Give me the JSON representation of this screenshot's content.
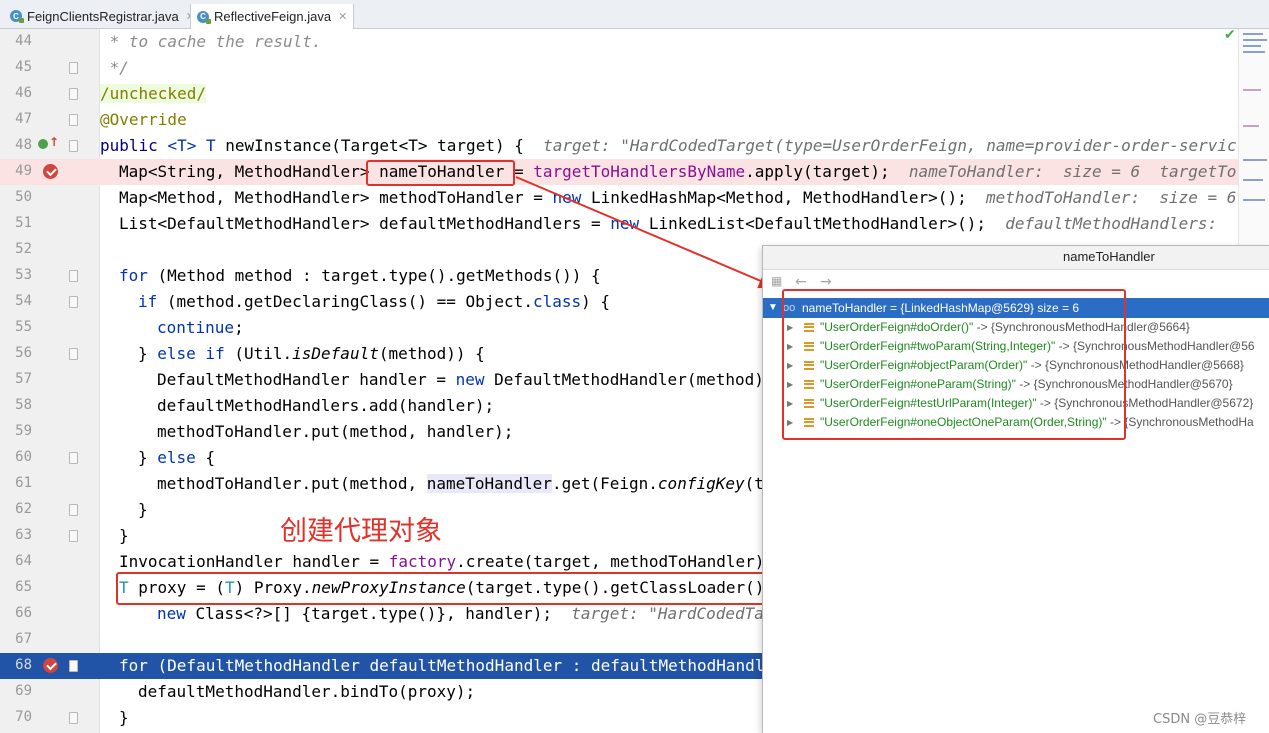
{
  "tabs": [
    {
      "label": "FeignClientsRegistrar.java",
      "active": false
    },
    {
      "label": "ReflectiveFeign.java",
      "active": true
    }
  ],
  "code_lines": {
    "l44": {
      "num": "44",
      "text": " * to cache the result."
    },
    "l45": {
      "num": "45",
      "text": " */"
    },
    "l46": {
      "num": "46",
      "text": "/unchecked/"
    },
    "l47": {
      "num": "47",
      "text": "@Override"
    },
    "l48": {
      "num": "48",
      "a": "public ",
      "b": "<T> T ",
      "c": "newInstance(Target<T> target) {  ",
      "inline": "target: \"HardCodedTarget(type=UserOrderFeign, name=provider-order-servic"
    },
    "l49": {
      "num": "49",
      "a": "Map<String, MethodHandler> ",
      "var": "nameToHandler",
      "b": " = ",
      "fld": "targetToHandlersByName",
      "c": ".apply(target);  ",
      "inline": "nameToHandler:  size = 6  targetTo"
    },
    "l50": {
      "num": "50",
      "a": "Map<Method, MethodHandler> methodToHandler = ",
      "kw": "new",
      "b": " LinkedHashMap<Method, MethodHandler>();  ",
      "inline": "methodToHandler:  size = 6"
    },
    "l51": {
      "num": "51",
      "a": "List<DefaultMethodHandler> defaultMethodHandlers = ",
      "kw": "new",
      "b": " LinkedList<DefaultMethodHandler>();  ",
      "inline": "defaultMethodHandlers:"
    },
    "l52": {
      "num": "52"
    },
    "l53": {
      "num": "53",
      "kw": "for",
      "a": " (Method method : target.type().getMethods()) {"
    },
    "l54": {
      "num": "54",
      "kw": "if",
      "a": " (method.getDeclaringClass() == Object.",
      "kw2": "class",
      "b": ") {"
    },
    "l55": {
      "num": "55",
      "kw": "continue",
      "a": ";"
    },
    "l56": {
      "num": "56",
      "a": "} ",
      "kw": "else if",
      "b": " (Util.",
      "it": "isDefault",
      "c": "(method)) {"
    },
    "l57": {
      "num": "57",
      "a": "DefaultMethodHandler handler = ",
      "kw": "new",
      "b": " DefaultMethodHandler(method)"
    },
    "l58": {
      "num": "58",
      "a": "defaultMethodHandlers.add(handler);"
    },
    "l59": {
      "num": "59",
      "a": "methodToHandler.put(method, handler);"
    },
    "l60": {
      "num": "60",
      "a": "} ",
      "kw": "else",
      "b": " {"
    },
    "l61": {
      "num": "61",
      "a": "methodToHandler.put(method, ",
      "ref": "nameToHandler",
      "b": ".get(Feign.",
      "it": "configKey",
      "c": "(t"
    },
    "l62": {
      "num": "62",
      "a": "}"
    },
    "l63": {
      "num": "63",
      "a": "}"
    },
    "l64": {
      "num": "64",
      "a": "InvocationHandler handler = ",
      "fld": "factory",
      "b": ".create(target, methodToHandler)"
    },
    "l65": {
      "num": "65",
      "gen": "T",
      "a": " proxy = (",
      "gen2": "T",
      "b": ") Proxy.",
      "it": "newProxyInstance",
      "c": "(target.type().getClassLoader()"
    },
    "l66": {
      "num": "66",
      "kw": "new",
      "a": " Class<?>[] {target.type()}, handler);  ",
      "inline": "target: \"HardCodedTa"
    },
    "l67": {
      "num": "67"
    },
    "l68": {
      "num": "68",
      "a": "for (DefaultMethodHandler defaultMethodHandler : defaultMethodHandl"
    },
    "l69": {
      "num": "69",
      "a": "defaultMethodHandler.bindTo(proxy);"
    },
    "l70": {
      "num": "70",
      "a": "}"
    }
  },
  "annotation_label": "创建代理对象",
  "popup": {
    "title": "nameToHandler",
    "root": "nameToHandler = {LinkedHashMap@5629}  size = 6",
    "root_prefix": "oo",
    "entries": [
      {
        "key": "\"UserOrderFeign#doOrder()\"",
        "val": " -> {SynchronousMethodHandler@5664}"
      },
      {
        "key": "\"UserOrderFeign#twoParam(String,Integer)\"",
        "val": " -> {SynchronousMethodHandler@56"
      },
      {
        "key": "\"UserOrderFeign#objectParam(Order)\"",
        "val": " -> {SynchronousMethodHandler@5668}"
      },
      {
        "key": "\"UserOrderFeign#oneParam(String)\"",
        "val": " -> {SynchronousMethodHandler@5670}"
      },
      {
        "key": "\"UserOrderFeign#testUrlParam(Integer)\"",
        "val": " -> {SynchronousMethodHandler@5672}"
      },
      {
        "key": "\"UserOrderFeign#oneObjectOneParam(Order,String)\"",
        "val": " -> {SynchronousMethodHa"
      }
    ]
  },
  "watermark": "CSDN @豆恭梓",
  "colors": {
    "breakpoint": "#d0453d",
    "selection": "#2154a6",
    "highlight_box": "#e0322a",
    "tree_key": "#1e8a1e"
  },
  "icons": [
    "class-file-icon",
    "close-icon",
    "breakpoint-icon",
    "implement-marker-icon",
    "fold-icon",
    "check-icon",
    "back-arrow-icon",
    "forward-arrow-icon",
    "list-entry-icon"
  ]
}
